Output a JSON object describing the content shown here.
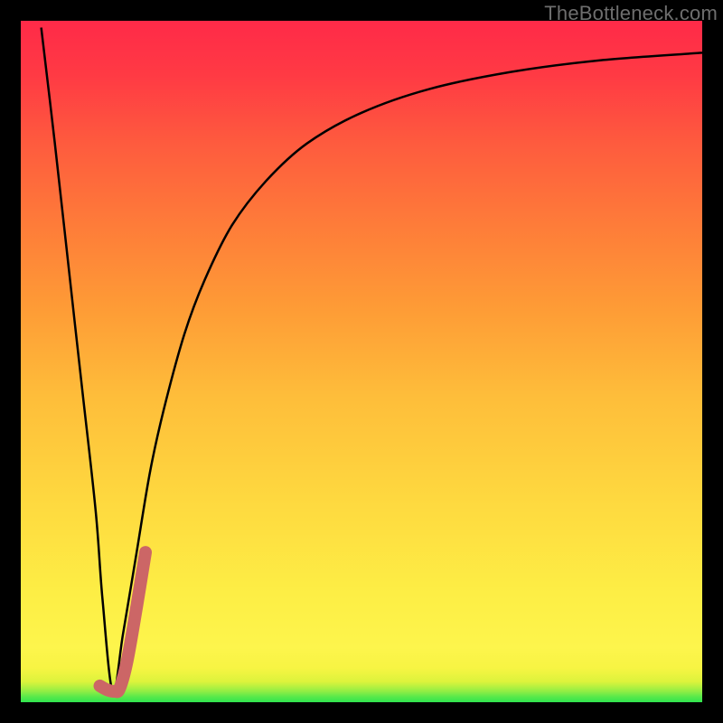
{
  "watermark": "TheBottleneck.com",
  "chart_data": {
    "type": "line",
    "title": "",
    "xlabel": "",
    "ylabel": "",
    "xlim": [
      0,
      100
    ],
    "ylim": [
      0,
      100
    ],
    "gradient_stops": [
      {
        "pos": 0,
        "color": "#2fe54f"
      },
      {
        "pos": 1,
        "color": "#58e94a"
      },
      {
        "pos": 2,
        "color": "#8aed45"
      },
      {
        "pos": 3,
        "color": "#dcf33c"
      },
      {
        "pos": 5,
        "color": "#f7f443"
      },
      {
        "pos": 8,
        "color": "#fdf54c"
      },
      {
        "pos": 30,
        "color": "#fed83f"
      },
      {
        "pos": 58,
        "color": "#fe9b36"
      },
      {
        "pos": 82,
        "color": "#fe5b3e"
      },
      {
        "pos": 100,
        "color": "#ff2a48"
      }
    ],
    "series": [
      {
        "name": "main-curve",
        "color": "#000000",
        "stroke_width": 2.5,
        "x": [
          3,
          5,
          7,
          9,
          11,
          12,
          13.5,
          15,
          17,
          19,
          21,
          24,
          27,
          31,
          36,
          42,
          50,
          60,
          72,
          85,
          100
        ],
        "y": [
          99,
          82,
          64,
          46,
          28,
          15,
          1.5,
          10,
          22,
          34,
          43,
          54,
          62,
          70,
          76.5,
          82,
          86.5,
          90,
          92.5,
          94.2,
          95.3
        ]
      },
      {
        "name": "hook-overlay",
        "color": "#cc6666",
        "stroke_width": 14,
        "linecap": "round",
        "x": [
          11.6,
          12.7,
          13.8,
          14.5,
          15.6,
          17.0,
          18.3
        ],
        "y": [
          2.4,
          1.8,
          1.6,
          2.0,
          6.0,
          14.0,
          22.0
        ]
      }
    ]
  }
}
